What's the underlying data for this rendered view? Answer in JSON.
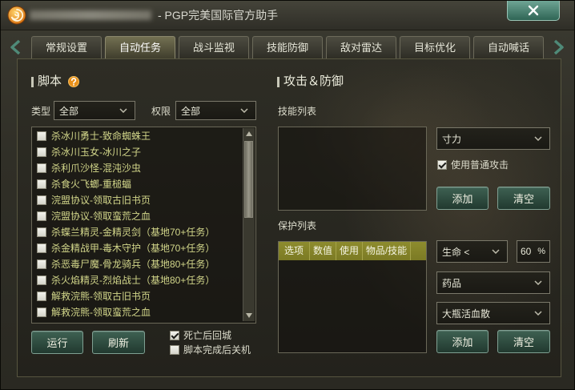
{
  "window": {
    "title": "- PGP完美国际官方助手",
    "logo_icon": "app-logo-icon",
    "close_icon": "close-icon"
  },
  "tab_nav": {
    "prev_icon": "chevron-left-icon",
    "next_icon": "chevron-right-icon"
  },
  "tabs": [
    {
      "label": "常规设置",
      "active": false
    },
    {
      "label": "自动任务",
      "active": true
    },
    {
      "label": "战斗监视",
      "active": false
    },
    {
      "label": "技能防御",
      "active": false
    },
    {
      "label": "敌对雷达",
      "active": false
    },
    {
      "label": "目标优化",
      "active": false
    },
    {
      "label": "自动喊话",
      "active": false
    }
  ],
  "script_panel": {
    "title": "脚本",
    "help_icon": "help-icon",
    "type_label": "类型",
    "type_value": "全部",
    "permission_label": "权限",
    "permission_value": "全部",
    "items": [
      {
        "label": "杀冰川勇士-致命蜘蛛王",
        "checked": false
      },
      {
        "label": "杀冰川玉女-冰川之子",
        "checked": false
      },
      {
        "label": "杀利爪沙怪-混沌沙虫",
        "checked": false
      },
      {
        "label": "杀食火飞螂-重槌蝠",
        "checked": false
      },
      {
        "label": "浣盟协议-领取古旧书页",
        "checked": false
      },
      {
        "label": "浣盟协议-领取蛮荒之血",
        "checked": false
      },
      {
        "label": "杀蝶兰精灵-金精灵剑（基地70+任务）",
        "checked": false
      },
      {
        "label": "杀金精战甲-毒木守护（基地70+任务）",
        "checked": false
      },
      {
        "label": "杀恶毒尸魔-骨龙骑兵（基地80+任务）",
        "checked": false
      },
      {
        "label": "杀火焰精灵-烈焰战士（基地80+任务）",
        "checked": false
      },
      {
        "label": "解救浣熊-领取古旧书页",
        "checked": false
      },
      {
        "label": "解救浣熊-领取蛮荒之血",
        "checked": false
      }
    ],
    "run_button": "运行",
    "refresh_button": "刷新",
    "options": [
      {
        "label": "死亡后回城",
        "checked": true
      },
      {
        "label": "脚本完成后关机",
        "checked": false
      }
    ]
  },
  "combat_panel": {
    "title": "攻击＆防御",
    "skill_list_label": "技能列表",
    "skill_select_value": "寸力",
    "use_normal_attack": {
      "label": "使用普通攻击",
      "checked": true
    },
    "skill_add_button": "添加",
    "skill_clear_button": "清空",
    "protect_list_label": "保护列表",
    "protect_columns": [
      "选项",
      "数值",
      "使用",
      "物品/技能"
    ],
    "condition_value": "生命 <",
    "threshold_value": "60",
    "threshold_unit": "%",
    "item_type_value": "药品",
    "item_value": "大瓶活血散",
    "protect_add_button": "添加",
    "protect_clear_button": "清空"
  },
  "colors": {
    "accent": "#4f8a78",
    "olive": "#7b7a24",
    "list_text": "#d2d68a",
    "background": "#2b2a22"
  }
}
